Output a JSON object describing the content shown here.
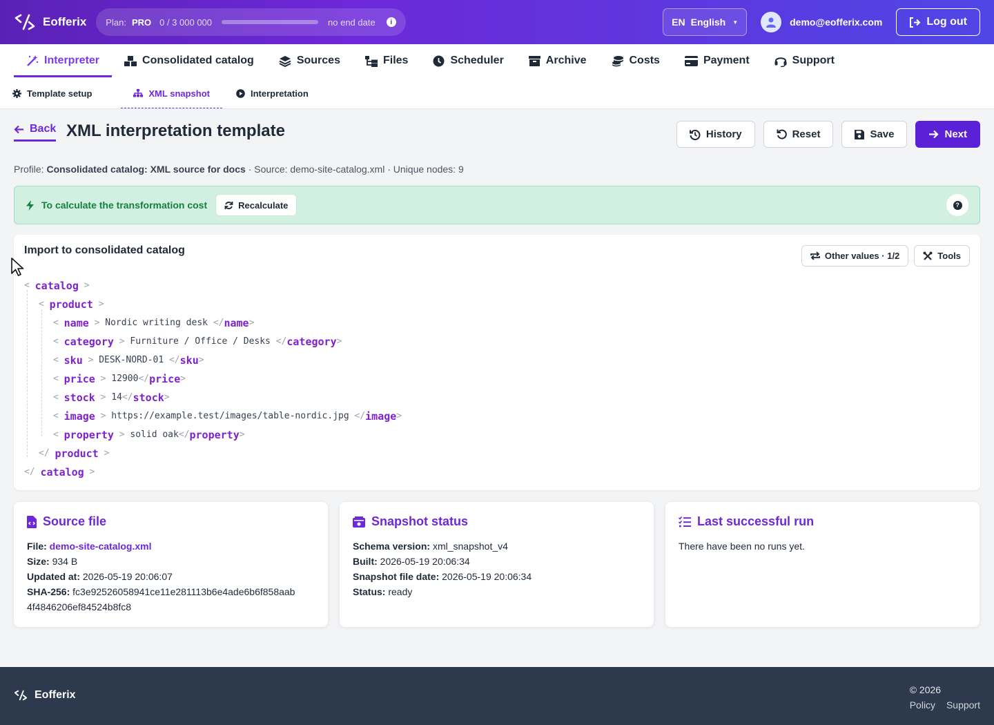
{
  "brand": {
    "name": "Eofferix"
  },
  "plan": {
    "label": "Plan:",
    "name": "PRO",
    "usage": "0 / 3 000 000",
    "progress_fraction": 0,
    "end": "no end date"
  },
  "language": {
    "code": "EN",
    "name": "English"
  },
  "user": {
    "email": "demo@eofferix.com"
  },
  "logout_label": "Log out",
  "main_nav": [
    {
      "label": "Interpreter",
      "icon": "magic-wand-icon",
      "active": true
    },
    {
      "label": "Consolidated catalog",
      "icon": "boxes-icon"
    },
    {
      "label": "Sources",
      "icon": "layers-icon"
    },
    {
      "label": "Files",
      "icon": "folder-tree-icon"
    },
    {
      "label": "Scheduler",
      "icon": "clock-icon"
    },
    {
      "label": "Archive",
      "icon": "archive-icon"
    },
    {
      "label": "Costs",
      "icon": "coins-icon"
    },
    {
      "label": "Payment",
      "icon": "credit-card-icon"
    },
    {
      "label": "Support",
      "icon": "headset-icon"
    }
  ],
  "sub_nav": [
    {
      "label": "Template setup",
      "icon": "gear-icon"
    },
    {
      "label": "XML snapshot",
      "icon": "sitemap-icon",
      "active": true
    },
    {
      "label": "Interpretation",
      "icon": "play-circle-icon"
    }
  ],
  "header": {
    "back_label": "Back",
    "title": "XML interpretation template",
    "actions": {
      "history": "History",
      "reset": "Reset",
      "save": "Save",
      "next": "Next"
    }
  },
  "profile": {
    "profile_label": "Profile:",
    "profile_value": "Consolidated catalog: XML source for docs",
    "source_text": "· Source: demo-site-catalog.xml · Unique nodes: 9"
  },
  "notice": {
    "text": "To calculate the transformation cost",
    "button": "Recalculate"
  },
  "xml_card": {
    "title": "Import to consolidated catalog",
    "other_values": "Other values · 1/2",
    "tools": "Tools",
    "root_tag": "catalog",
    "item_tag": "product",
    "fields": [
      {
        "tag": "name",
        "value": "Nordic writing desk "
      },
      {
        "tag": "category",
        "value": "Furniture / Office / Desks "
      },
      {
        "tag": "sku",
        "value": "DESK-NORD-01 "
      },
      {
        "tag": "price",
        "value": "12900"
      },
      {
        "tag": "stock",
        "value": "14"
      },
      {
        "tag": "image",
        "value": "https://example.test/images/table-nordic.jpg "
      },
      {
        "tag": "property",
        "value": "solid oak"
      }
    ]
  },
  "source_file": {
    "title": "Source file",
    "file_label": "File:",
    "file": "demo-site-catalog.xml",
    "size_label": "Size:",
    "size": "934 B",
    "updated_label": "Updated at:",
    "updated": "2026-05-19 20:06:07",
    "sha_label": "SHA-256:",
    "sha_line1": "fc3e92526058941ce11e281113b6e4ade6b6f858aab",
    "sha_line2": "4f4846206ef84524b8fc8"
  },
  "snapshot": {
    "title": "Snapshot status",
    "schema_label": "Schema version:",
    "schema": "xml_snapshot_v4",
    "built_label": "Built:",
    "built": "2026-05-19 20:06:34",
    "file_date_label": "Snapshot file date:",
    "file_date": "2026-05-19 20:06:34",
    "status_label": "Status:",
    "status": "ready"
  },
  "last_run": {
    "title": "Last successful run",
    "text": "There have been no runs yet."
  },
  "footer": {
    "brand": "Eofferix",
    "copyright": "© 2026",
    "policy": "Policy",
    "support": "Support"
  },
  "colors": {
    "accent": "#6d28d9",
    "primary_button": "#5b21d6",
    "notice_bg": "#d1f0e2",
    "notice_text": "#15803d",
    "footer_bg": "#2d3a4d"
  }
}
